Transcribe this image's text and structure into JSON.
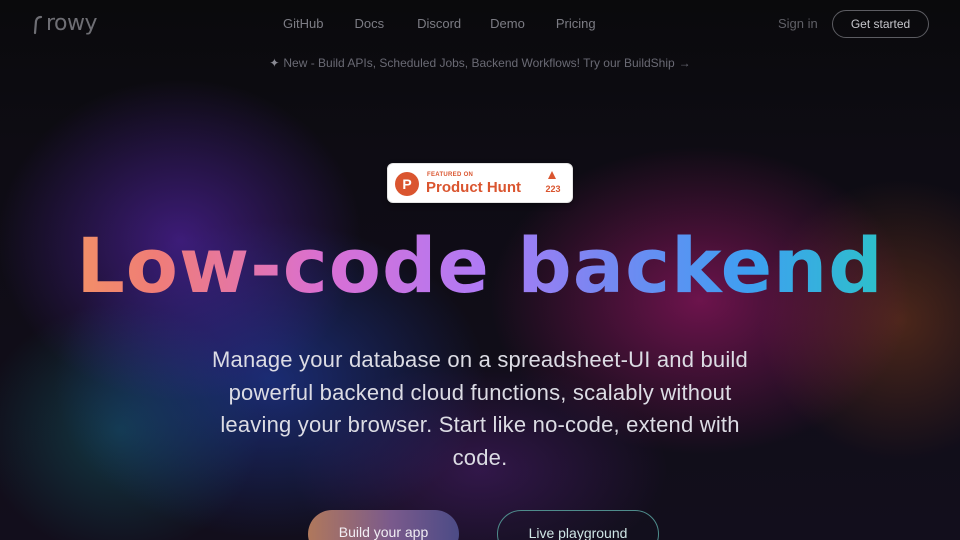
{
  "brand": {
    "name": "rowy"
  },
  "nav": {
    "links": [
      "GitHub",
      "Docs",
      "Discord",
      "Demo",
      "Pricing"
    ],
    "sign_in": "Sign in",
    "get_started": "Get started"
  },
  "announcement": {
    "icon": "sparkle-icon",
    "text": "New - Build APIs, Scheduled Jobs, Backend Workflows! Try our BuildShip",
    "arrow": "→"
  },
  "product_hunt": {
    "featured_label": "FEATURED ON",
    "name": "Product Hunt",
    "logo_letter": "P",
    "upvotes": "223",
    "brand_color": "#da552f"
  },
  "hero": {
    "title": "Low-code backend",
    "subtitle": "Manage your database on a spreadsheet-UI and build powerful backend cloud functions, scalably without leaving your browser. Start like no-code, extend with code."
  },
  "cta": {
    "primary": "Build your app",
    "secondary": "Live playground"
  },
  "colors": {
    "background": "#0b0b0e",
    "title_gradient": [
      "#f4a259",
      "#d96fd4",
      "#7a86f2",
      "#23d4b4"
    ]
  }
}
